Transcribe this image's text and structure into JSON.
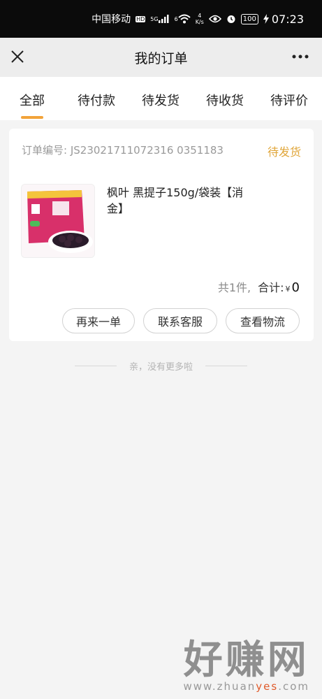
{
  "status_bar": {
    "carrier": "中国移动",
    "hd": "HD",
    "signal": "5G",
    "wifi_label": "6",
    "speed_value": "4",
    "speed_unit": "K/s",
    "battery": "100",
    "time": "07:23"
  },
  "navbar": {
    "title": "我的订单",
    "more": "•••"
  },
  "tabs": [
    {
      "label": "全部",
      "active": true
    },
    {
      "label": "待付款",
      "active": false
    },
    {
      "label": "待发货",
      "active": false
    },
    {
      "label": "待收货",
      "active": false
    },
    {
      "label": "待评价",
      "active": false
    }
  ],
  "order": {
    "number_label": "订单编号:",
    "number": "JS23021711072316 0351183",
    "status": "待发货",
    "product": {
      "title": "枫叶 黑提子150g/袋装【消金】",
      "image_icon": "raisin-package-image"
    },
    "count_text": "共1件,",
    "total_label": "合计:",
    "currency": "¥",
    "total_amount": "0",
    "buttons": {
      "reorder": "再来一单",
      "contact": "联系客服",
      "logistics": "查看物流"
    }
  },
  "end_hint": "亲，没有更多啦",
  "watermark": {
    "text": "好赚网",
    "url_prefix": "www.zhuan",
    "url_highlight": "yes",
    "url_suffix": ".com"
  },
  "colors": {
    "accent": "#f2a33a",
    "status": "#e0a63a",
    "background": "#f4f4f4"
  }
}
